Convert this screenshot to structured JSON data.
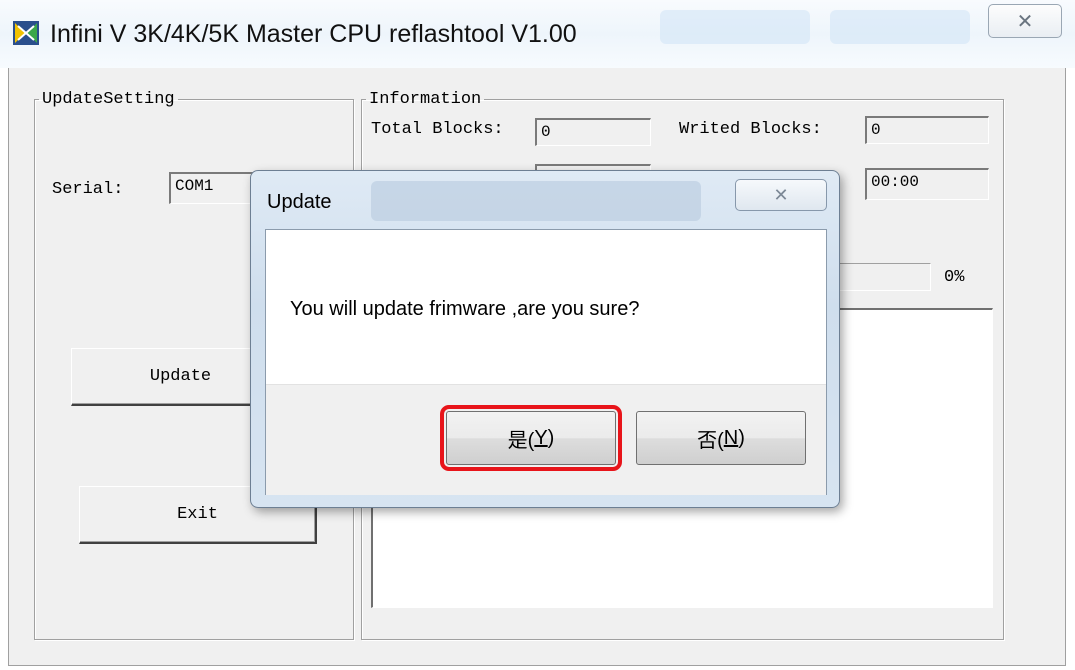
{
  "window": {
    "title": "Infini V 3K/4K/5K Master CPU reflashtool V1.00",
    "close_glyph": "✕"
  },
  "update_setting": {
    "legend": "UpdateSetting",
    "serial_label": "Serial:",
    "serial_value": "COM1",
    "update_button": "Update",
    "exit_button": "Exit"
  },
  "information": {
    "legend": "Information",
    "total_blocks_label": "Total Blocks:",
    "total_blocks_value": "0",
    "writed_blocks_label": "Writed Blocks:",
    "writed_blocks_value": "0",
    "time_value": "00:00",
    "progress_percent": "0%",
    "progress_fraction": 0
  },
  "dialog": {
    "title": "Update",
    "close_glyph": "✕",
    "message": "You will update frimware ,are you sure?",
    "yes_text": "是(",
    "yes_key": "Y",
    "yes_end": ")",
    "no_text": "否(",
    "no_key": "N",
    "no_end": ")"
  },
  "colors": {
    "highlight": "#e8141a",
    "dialog_frame": "#cfdeed"
  },
  "icons": {
    "app": "app-icon",
    "close": "close-icon"
  }
}
